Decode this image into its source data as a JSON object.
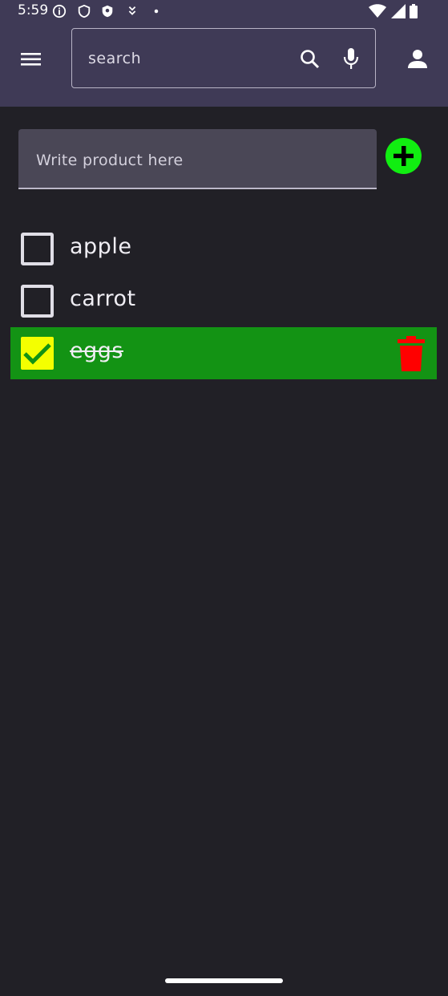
{
  "status_bar": {
    "time": "5:59"
  },
  "app_bar": {
    "search_placeholder": "search",
    "icons": [
      "menu-icon",
      "search-icon",
      "mic-icon",
      "person-icon"
    ]
  },
  "add_product": {
    "placeholder": "Write product here",
    "add_icon": "plus-icon",
    "add_color": "#11ee11"
  },
  "items": [
    {
      "name": "apple",
      "checked": false
    },
    {
      "name": "carrot",
      "checked": false
    },
    {
      "name": "eggs",
      "checked": true
    }
  ],
  "colors": {
    "app_bar": "#3f3a56",
    "background": "#212026",
    "checked_row": "#139314",
    "checked_box": "#f4ff00",
    "delete_icon": "#ff0000"
  }
}
